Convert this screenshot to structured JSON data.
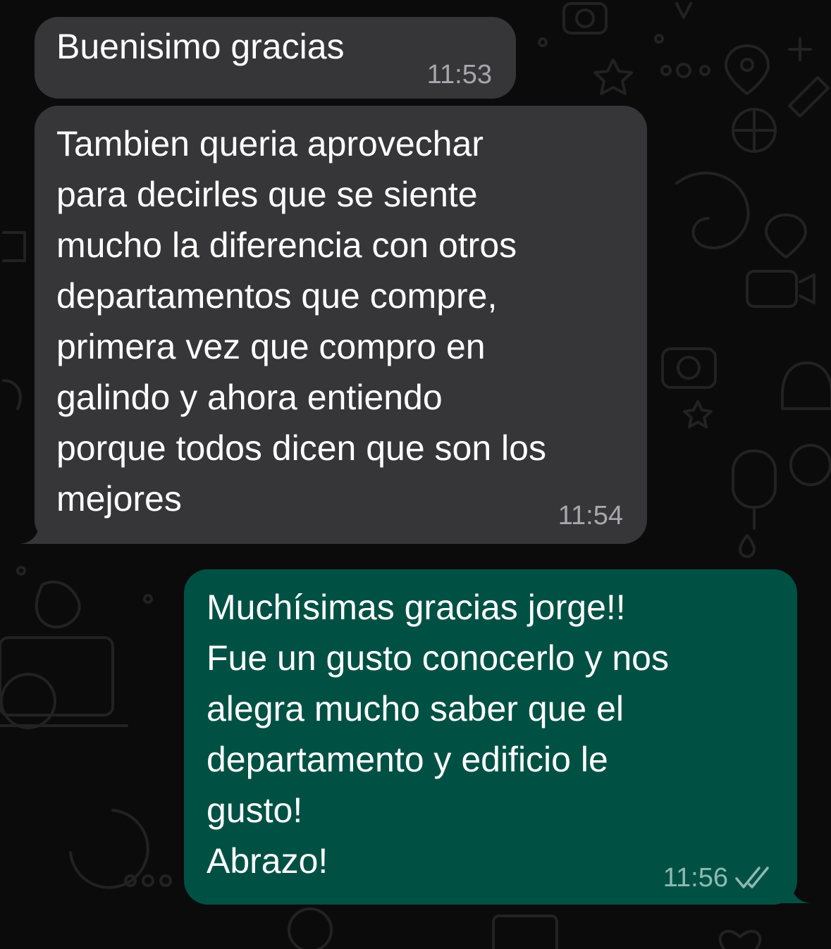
{
  "chat": {
    "messages": [
      {
        "direction": "incoming",
        "text": "Buenisimo gracias",
        "time": "11:53"
      },
      {
        "direction": "incoming",
        "text": "Tambien queria aprovechar\npara decirles que se siente\nmucho la diferencia con otros\ndepartamentos que compre,\nprimera vez que compro en\ngalindo y ahora entiendo\nporque todos dicen que son los\nmejores",
        "time": "11:54"
      },
      {
        "direction": "outgoing",
        "text": "Muchísimas gracias jorge!!\nFue un gusto conocerlo y nos\nalegra mucho saber que el\ndepartamento y edificio le\ngusto!\nAbrazo!",
        "time": "11:56",
        "status_icon": "double-check-read-icon"
      }
    ]
  },
  "colors": {
    "background": "#0b0b0b",
    "incoming_bubble": "#363638",
    "outgoing_bubble": "#005144",
    "text": "#ffffff"
  },
  "wallpaper": {
    "pattern": "doodle-icons"
  }
}
